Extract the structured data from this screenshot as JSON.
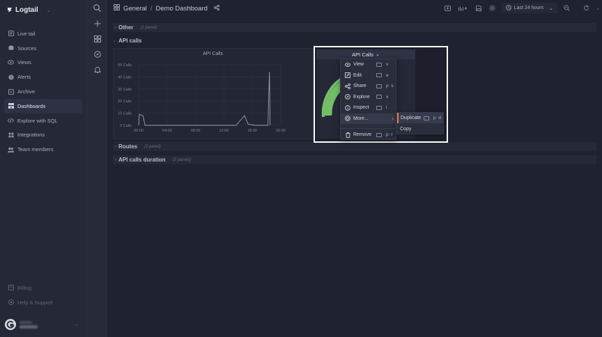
{
  "app": {
    "brand": "Logtail"
  },
  "sidebar": {
    "items": [
      {
        "label": "Live tail",
        "icon": "list-icon",
        "active": false
      },
      {
        "label": "Sources",
        "icon": "sources-icon",
        "active": false
      },
      {
        "label": "Views",
        "icon": "eye-icon",
        "active": false
      },
      {
        "label": "Alerts",
        "icon": "alert-icon",
        "active": false
      },
      {
        "label": "Archive",
        "icon": "archive-icon",
        "active": false
      },
      {
        "label": "Dashboards",
        "icon": "dashboard-icon",
        "active": true
      },
      {
        "label": "Explore with SQL",
        "icon": "code-icon",
        "active": false
      },
      {
        "label": "Integrations",
        "icon": "integrations-icon",
        "active": false
      },
      {
        "label": "Team members",
        "icon": "team-icon",
        "active": false
      }
    ],
    "bottom": [
      {
        "label": "Billing",
        "icon": "billing-icon"
      },
      {
        "label": "Help & Support",
        "icon": "help-icon"
      }
    ]
  },
  "breadcrumb": {
    "folder": "General",
    "separator": "/",
    "title": "Demo Dashboard"
  },
  "topbar": {
    "time_range": "Last 24 hours"
  },
  "rows": {
    "other": {
      "title": "Other",
      "count": "(1 panel)"
    },
    "api_calls": {
      "title": "API calls"
    },
    "routes": {
      "title": "Routes",
      "count": "(1 panel)"
    },
    "api_duration": {
      "title": "API calls duration",
      "count": "(2 panels)"
    }
  },
  "panel": {
    "title": "API Calls"
  },
  "focused_panel": {
    "title": "API Calls"
  },
  "menu": {
    "items": [
      {
        "label": "View",
        "icon": "eye-icon",
        "keys": "v"
      },
      {
        "label": "Edit",
        "icon": "edit-icon",
        "keys": "e"
      },
      {
        "label": "Share",
        "icon": "share-icon",
        "keys": "p s"
      },
      {
        "label": "Explore",
        "icon": "compass-icon",
        "keys": "x"
      },
      {
        "label": "Inspect",
        "icon": "info-icon",
        "keys": "i"
      },
      {
        "label": "More...",
        "icon": "cube-icon",
        "keys": ""
      },
      {
        "label": "Remove",
        "icon": "trash-icon",
        "keys": "p r"
      }
    ],
    "submenu": [
      {
        "label": "Duplicate",
        "keys": "p d"
      },
      {
        "label": "Copy",
        "keys": ""
      }
    ]
  },
  "colors": {
    "accent": "#f0794c",
    "gauge": "#73bf69",
    "background": "#1f2230"
  },
  "chart_data": {
    "type": "line",
    "title": "API Calls",
    "x": [
      "00:00",
      "04:00",
      "08:00",
      "12:00",
      "16:00",
      "20:00"
    ],
    "y_ticks": [
      "0 Calls",
      "10 Calls",
      "20 Calls",
      "30 Calls",
      "40 Calls",
      "50 Calls"
    ],
    "ylim": [
      0,
      50
    ],
    "grid": true,
    "series": [
      {
        "points": [
          [
            0.0,
            0
          ],
          [
            0.1,
            9
          ],
          [
            0.6,
            8
          ],
          [
            0.9,
            0
          ],
          [
            1.5,
            0
          ],
          [
            4.0,
            0
          ],
          [
            8.0,
            0
          ],
          [
            12.0,
            0
          ],
          [
            13.7,
            0
          ],
          [
            14.9,
            8
          ],
          [
            15.4,
            1
          ],
          [
            16.4,
            0
          ],
          [
            18.2,
            0
          ],
          [
            18.4,
            44
          ],
          [
            18.5,
            0
          ]
        ]
      }
    ]
  }
}
